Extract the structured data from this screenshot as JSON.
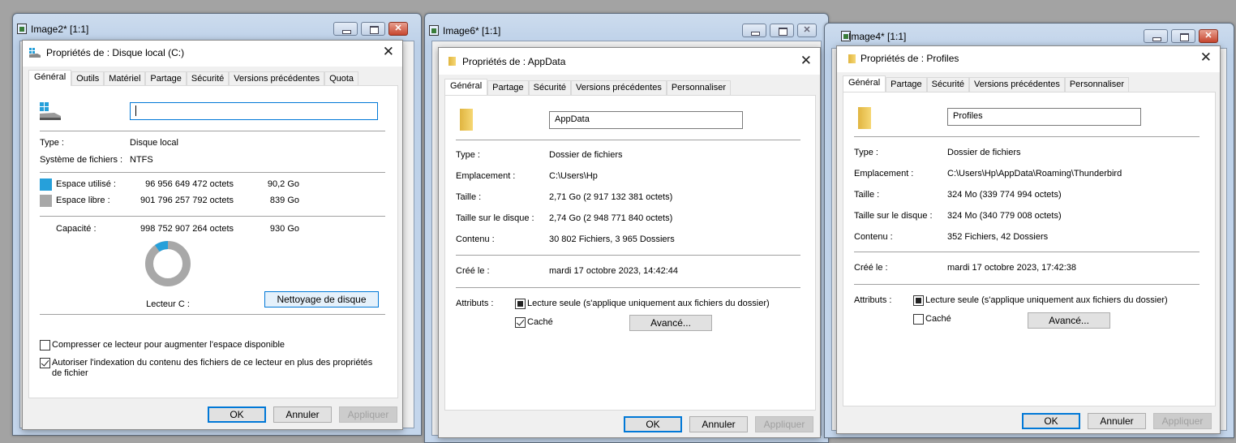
{
  "colors": {
    "used": "#26a0da",
    "free": "#a8a8a8",
    "accent": "#0078d7"
  },
  "windows": [
    {
      "title": "Image2* [1:1]",
      "icon": "image-viewer-icon",
      "dialog": {
        "title": "Propriétés de : Disque local (C:)",
        "icon": "drive-icon",
        "tabs": [
          "Général",
          "Outils",
          "Matériel",
          "Partage",
          "Sécurité",
          "Versions précédentes",
          "Quota"
        ],
        "name_value": "",
        "type_label": "Type :",
        "type_value": "Disque local",
        "fs_label": "Système de fichiers :",
        "fs_value": "NTFS",
        "used_label": "Espace utilisé :",
        "used_bytes": "96 956 649 472 octets",
        "used_size": "90,2 Go",
        "free_label": "Espace libre :",
        "free_bytes": "901 796 257 792 octets",
        "free_size": "839 Go",
        "capacity_label": "Capacité :",
        "capacity_bytes": "998 752 907 264 octets",
        "capacity_size": "930 Go",
        "used_fraction": 0.097,
        "drive_label": "Lecteur C :",
        "cleanup_button": "Nettoyage de disque",
        "compress_label": "Compresser ce lecteur pour augmenter l'espace disponible",
        "compress_checked": false,
        "index_label": "Autoriser l'indexation du contenu des fichiers de ce lecteur en plus des propriétés de fichier",
        "index_checked": true,
        "ok": "OK",
        "cancel": "Annuler",
        "apply": "Appliquer"
      }
    },
    {
      "title": "Image6* [1:1]",
      "icon": "image-viewer-icon",
      "dialog": {
        "title": "Propriétés de : AppData",
        "icon": "folder-icon",
        "tabs": [
          "Général",
          "Partage",
          "Sécurité",
          "Versions précédentes",
          "Personnaliser"
        ],
        "name_value": "AppData",
        "type_label": "Type :",
        "type_value": "Dossier de fichiers",
        "location_label": "Emplacement :",
        "location_value": "C:\\Users\\Hp",
        "size_label": "Taille :",
        "size_value": "2,71 Go (2 917 132 381 octets)",
        "disk_size_label": "Taille sur le disque :",
        "disk_size_value": "2,74 Go (2 948 771 840 octets)",
        "contents_label": "Contenu :",
        "contents_value": "30 802 Fichiers, 3 965 Dossiers",
        "created_label": "Créé le :",
        "created_value": "mardi 17 octobre 2023, 14:42:44",
        "attributes_label": "Attributs :",
        "readonly_label": "Lecture seule (s'applique uniquement aux fichiers du dossier)",
        "readonly_state": "indeterminate",
        "hidden_label": "Caché",
        "hidden_checked": true,
        "advanced_button": "Avancé...",
        "ok": "OK",
        "cancel": "Annuler",
        "apply": "Appliquer"
      }
    },
    {
      "title": "Image4* [1:1]",
      "icon": "image-viewer-icon",
      "dialog": {
        "title": "Propriétés de : Profiles",
        "icon": "folder-icon",
        "tabs": [
          "Général",
          "Partage",
          "Sécurité",
          "Versions précédentes",
          "Personnaliser"
        ],
        "name_value": "Profiles",
        "type_label": "Type :",
        "type_value": "Dossier de fichiers",
        "location_label": "Emplacement :",
        "location_value": "C:\\Users\\Hp\\AppData\\Roaming\\Thunderbird",
        "size_label": "Taille :",
        "size_value": "324 Mo (339 774 994 octets)",
        "disk_size_label": "Taille sur le disque :",
        "disk_size_value": "324 Mo (340 779 008 octets)",
        "contents_label": "Contenu :",
        "contents_value": "352 Fichiers, 42 Dossiers",
        "created_label": "Créé le :",
        "created_value": "mardi 17 octobre 2023, 17:42:38",
        "attributes_label": "Attributs :",
        "readonly_label": "Lecture seule (s'applique uniquement aux fichiers du dossier)",
        "readonly_state": "indeterminate",
        "hidden_label": "Caché",
        "hidden_checked": false,
        "advanced_button": "Avancé...",
        "ok": "OK",
        "cancel": "Annuler",
        "apply": "Appliquer"
      }
    }
  ]
}
